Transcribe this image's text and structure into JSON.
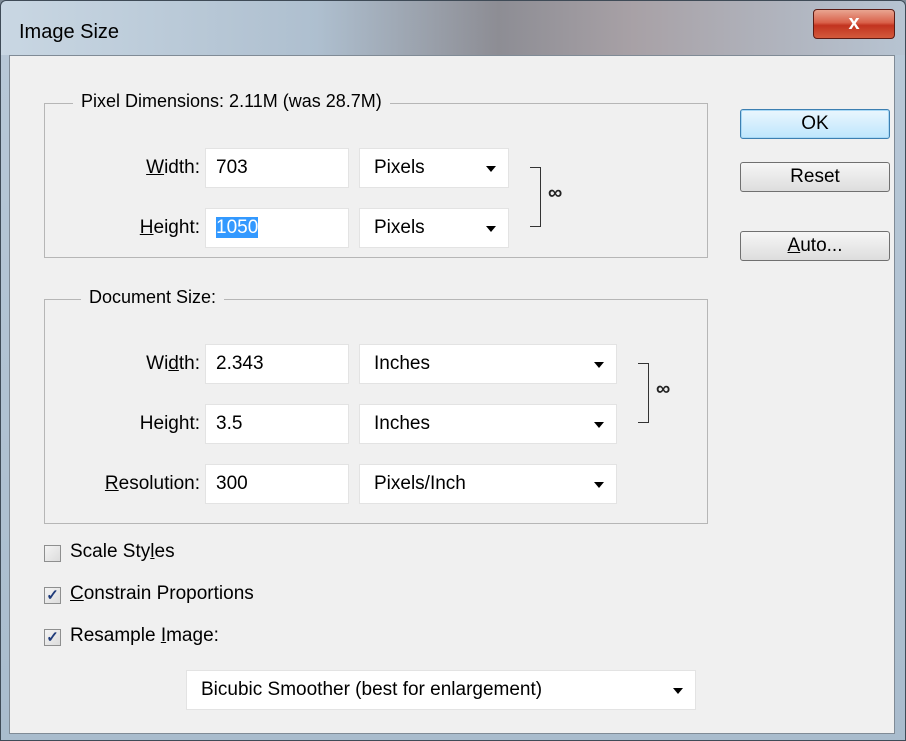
{
  "window": {
    "title": "Image Size",
    "close_glyph": "x"
  },
  "pixel_dimensions": {
    "legend": "Pixel Dimensions:  2.11M (was 28.7M)",
    "width": {
      "label_pre": "",
      "label_key": "W",
      "label_post": "idth:",
      "value": "703",
      "unit": "Pixels"
    },
    "height": {
      "label_pre": "",
      "label_key": "H",
      "label_post": "eight:",
      "value": "1050",
      "unit": "Pixels"
    }
  },
  "document_size": {
    "legend": "Document Size:",
    "width": {
      "label_pre": "Wi",
      "label_key": "d",
      "label_post": "th:",
      "value": "2.343",
      "unit": "Inches"
    },
    "height": {
      "label_pre": "Hei",
      "label_key": "g",
      "label_post": "ht:",
      "value": "3.5",
      "unit": "Inches"
    },
    "resolution": {
      "label_pre": "",
      "label_key": "R",
      "label_post": "esolution:",
      "value": "300",
      "unit": "Pixels/Inch"
    }
  },
  "buttons": {
    "ok": "OK",
    "reset": "Reset",
    "auto": {
      "key": "A",
      "rest": "uto..."
    }
  },
  "options": {
    "scale_styles": {
      "pre": "Scale Sty",
      "key": "l",
      "post": "es",
      "checked": false
    },
    "constrain": {
      "pre": "",
      "key": "C",
      "post": "onstrain Proportions",
      "checked": true
    },
    "resample": {
      "pre": "Resample ",
      "key": "I",
      "post": "mage:",
      "checked": true
    }
  },
  "resample_method": "Bicubic Smoother (best for enlargement)",
  "icons": {
    "link": "chain-link-icon",
    "check": "checkmark-icon"
  }
}
